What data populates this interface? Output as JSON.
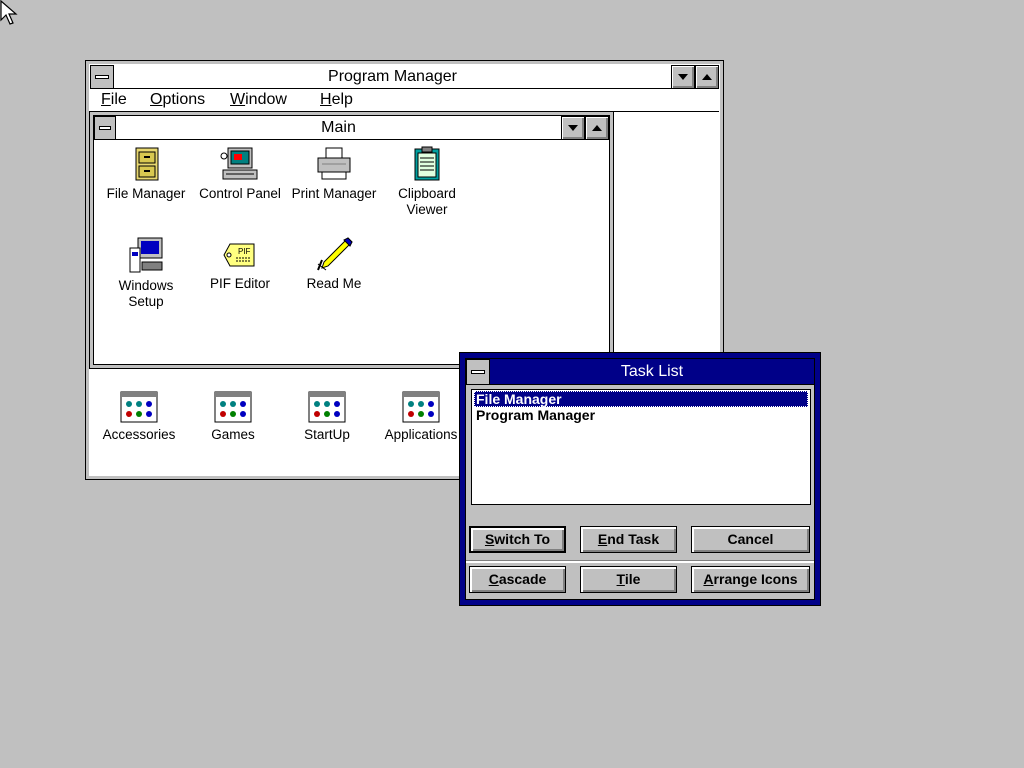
{
  "program_manager": {
    "title": "Program Manager",
    "menu": [
      {
        "accel": "F",
        "rest": "ile"
      },
      {
        "accel": "O",
        "rest": "ptions"
      },
      {
        "accel": "W",
        "rest": "indow"
      },
      {
        "accel": "H",
        "rest": "elp"
      }
    ],
    "main_group": {
      "title": "Main",
      "icons": [
        {
          "name": "file-manager-icon",
          "line1": "File Manager",
          "line2": ""
        },
        {
          "name": "control-panel-icon",
          "line1": "Control Panel",
          "line2": ""
        },
        {
          "name": "print-manager-icon",
          "line1": "Print Manager",
          "line2": ""
        },
        {
          "name": "clipboard-viewer-icon",
          "line1": "Clipboard",
          "line2": "Viewer"
        },
        {
          "name": "windows-setup-icon",
          "line1": "Windows",
          "line2": "Setup"
        },
        {
          "name": "pif-editor-icon",
          "line1": "PIF Editor",
          "line2": ""
        },
        {
          "name": "read-me-icon",
          "line1": "Read Me",
          "line2": ""
        }
      ]
    },
    "minimized_groups": [
      "Accessories",
      "Games",
      "StartUp",
      "Applications"
    ]
  },
  "task_list": {
    "title": "Task List",
    "items": [
      "File Manager",
      "Program Manager"
    ],
    "selected_index": 0,
    "buttons_row1": [
      {
        "accel": "S",
        "rest": "witch To"
      },
      {
        "accel": "E",
        "rest": "nd Task"
      },
      {
        "accel": "",
        "rest": "Cancel"
      }
    ],
    "buttons_row2": [
      {
        "accel": "C",
        "rest": "ascade"
      },
      {
        "accel": "T",
        "rest": "ile"
      },
      {
        "accel": "A",
        "rest": "rrange Icons"
      }
    ]
  },
  "colors": {
    "desktop": "#c0c0c0",
    "active_title": "#000088",
    "window": "#ffffff"
  }
}
